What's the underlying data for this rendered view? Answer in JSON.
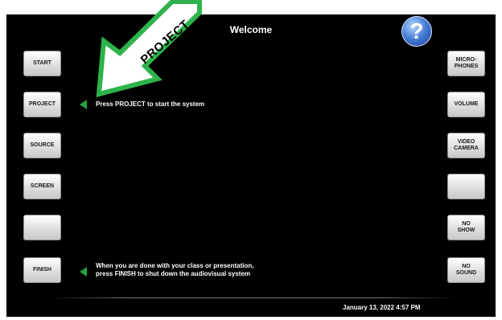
{
  "header": {
    "title": "Welcome",
    "help_label": "?"
  },
  "left_buttons": [
    {
      "label": "START"
    },
    {
      "label": "PROJECT"
    },
    {
      "label": "SOURCE"
    },
    {
      "label": "SCREEN"
    },
    {
      "label": ""
    },
    {
      "label": "FINISH"
    }
  ],
  "right_buttons": [
    {
      "label": "MICRO-\nPHONES"
    },
    {
      "label": "VOLUME"
    },
    {
      "label": "VIDEO\nCAMERA"
    },
    {
      "label": ""
    },
    {
      "label": "NO\nSHOW"
    },
    {
      "label": "NO\nSOUND"
    }
  ],
  "messages": {
    "project_hint": "Press PROJECT to start the system",
    "finish_hint": "When you are done with your class or presentation,\npress FINISH to shut down the audiovisual system"
  },
  "footer": {
    "datetime": "January 13, 2022 4:57 PM"
  },
  "callout": {
    "label": "PROJECT",
    "color": "#2db34a"
  },
  "colors": {
    "marker": "#21a341",
    "background": "#000000"
  }
}
